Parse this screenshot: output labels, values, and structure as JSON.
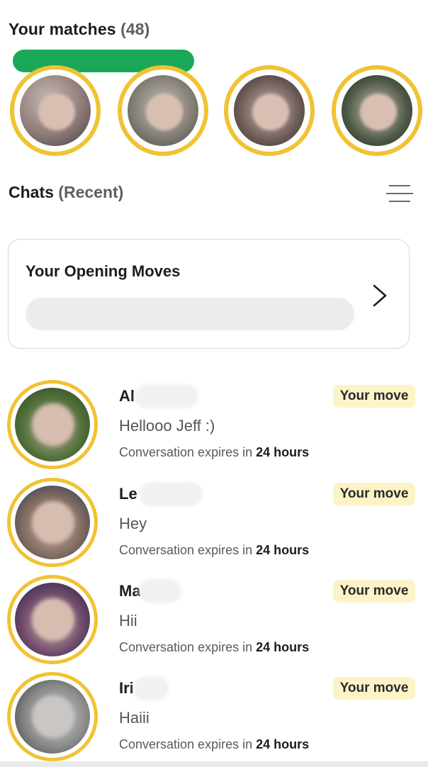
{
  "matches": {
    "title": "Your matches",
    "count": "(48)",
    "ring_color": "#f1c232",
    "redaction_color": "#1aa858",
    "avatars": [
      {
        "alt": "match-1"
      },
      {
        "alt": "match-2"
      },
      {
        "alt": "match-3"
      },
      {
        "alt": "match-4"
      }
    ]
  },
  "chats": {
    "title": "Chats",
    "subtitle": "(Recent)",
    "filter_icon": "filter-lines-icon"
  },
  "opening_moves": {
    "title": "Your Opening Moves",
    "chevron_icon": "chevron-right-icon"
  },
  "chat_list": [
    {
      "name": "Al",
      "message": "Hellooo Jeff :)",
      "expiry_prefix": "Conversation expires in",
      "expiry_time": "24 hours",
      "badge": "Your move"
    },
    {
      "name": "Le",
      "message": "Hey",
      "expiry_prefix": "Conversation expires in",
      "expiry_time": "24 hours",
      "badge": "Your move"
    },
    {
      "name": "Ma",
      "message": "Hii",
      "expiry_prefix": "Conversation expires in",
      "expiry_time": "24 hours",
      "badge": "Your move"
    },
    {
      "name": "Iri",
      "message": "Haiii",
      "expiry_prefix": "Conversation expires in",
      "expiry_time": "24 hours",
      "badge": "Your move"
    }
  ],
  "colors": {
    "accent_yellow": "#f1c232",
    "badge_bg": "#fcf3c7",
    "text_dark": "#1d1d1d",
    "text_muted": "#5f5f5f"
  }
}
